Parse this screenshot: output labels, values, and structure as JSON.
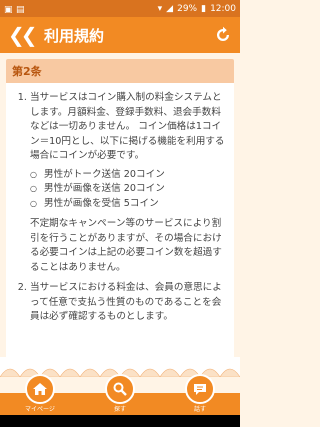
{
  "status": {
    "battery": "29%",
    "time": "12:00"
  },
  "header": {
    "title": "利用規約"
  },
  "section": {
    "title": "第2条"
  },
  "items": [
    {
      "text": "当サービスはコイン購入制の料金システムとします。月額料金、登録手数料、退会手数料などは一切ありません。 コイン価格は1コイン＝10円とし、以下に掲げる機能を利用する場合にコインが必要です。",
      "sub": [
        "男性がトーク送信 20コイン",
        "男性が画像を送信 20コイン",
        "男性が画像を受信 5コイン"
      ],
      "after": "不定期なキャンペーン等のサービスにより割引を行うことがありますが、その場合における必要コインは上記の必要コイン数を超過することはありません。"
    },
    {
      "text": "当サービスにおける料金は、会員の意思によって任意で支払う性質のものであることを会員は必ず確認するものとします。"
    }
  ],
  "nav": {
    "mypage": "マイページ",
    "search": "探す",
    "talk": "話す"
  }
}
